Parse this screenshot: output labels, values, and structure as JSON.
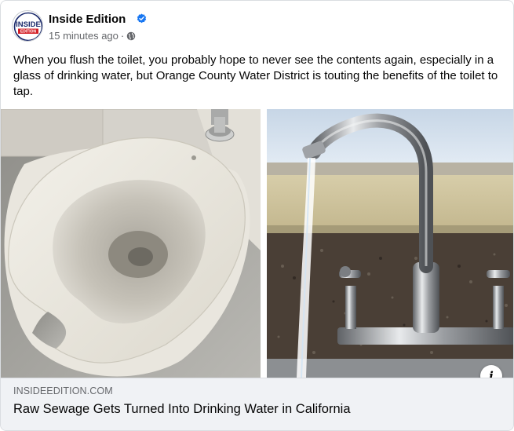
{
  "post": {
    "author": "Inside Edition",
    "timestamp": "15 minutes ago",
    "separator": "·",
    "avatar_text_top": "INSIDE",
    "avatar_text_bottom": "EDITION",
    "verified_icon": "verified-badge-icon",
    "audience_icon": "globe-icon",
    "text": "When you flush the toilet, you probably hope to never see the contents again, especially in a glass of drinking water, but Orange County Water District is touting the benefits of the toilet to tap."
  },
  "media": {
    "left_image": "toilet-photo",
    "right_image": "faucet-photo",
    "info_label": "i"
  },
  "link": {
    "domain": "INSIDEEDITION.COM",
    "title": "Raw Sewage Gets Turned Into Drinking Water in California"
  },
  "colors": {
    "brand_blue": "#1877f2",
    "logo_red": "#d32027",
    "logo_navy": "#1b2a6b",
    "secondary_text": "#65676b",
    "footer_bg": "#f0f2f5"
  }
}
